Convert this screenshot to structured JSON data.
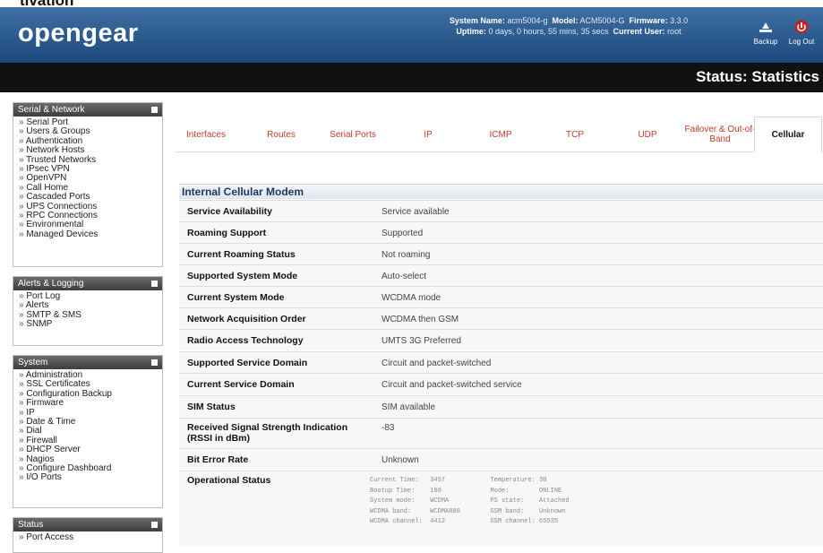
{
  "cut_title": "tivation",
  "header": {
    "logo": "opengear",
    "system_name_label": "System Name:",
    "system_name": "acm5004-g",
    "model_label": "Model:",
    "model": "ACM5004-G",
    "firmware_label": "Firmware:",
    "firmware": "3.3.0",
    "uptime_label": "Uptime:",
    "uptime": "0 days, 0 hours, 55 mins, 35 secs",
    "user_label": "Current User:",
    "user": "root",
    "backup_label": "Backup",
    "logout_label": "Log Out"
  },
  "page_title": "Status: Statistics",
  "sidebar": {
    "serial_network": {
      "title": "Serial & Network",
      "items": [
        "Serial Port",
        "Users & Groups",
        "Authentication",
        "Network Hosts",
        "Trusted Networks",
        "IPsec VPN",
        "OpenVPN",
        "Call Home",
        "Cascaded Ports",
        "UPS Connections",
        "RPC Connections",
        "Environmental",
        "Managed Devices"
      ]
    },
    "alerts_logging": {
      "title": "Alerts & Logging",
      "items": [
        "Port Log",
        "Alerts",
        "SMTP & SMS",
        "SNMP"
      ]
    },
    "system": {
      "title": "System",
      "items": [
        "Administration",
        "SSL Certificates",
        "Configuration Backup",
        "Firmware",
        "IP",
        "Date & Time",
        "Dial",
        "Firewall",
        "DHCP Server",
        "Nagios",
        "Configure Dashboard",
        "I/O Ports"
      ]
    },
    "status": {
      "title": "Status",
      "items": [
        "Port Access"
      ]
    }
  },
  "tabs": [
    "Interfaces",
    "Routes",
    "Serial Ports",
    "IP",
    "ICMP",
    "TCP",
    "UDP",
    "Failover & Out-of-Band",
    "Cellular"
  ],
  "active_tab": "Cellular",
  "section_title": "Internal Cellular Modem",
  "rows": [
    {
      "label": "Service Availability",
      "value": "Service available"
    },
    {
      "label": "Roaming Support",
      "value": "Supported"
    },
    {
      "label": "Current Roaming Status",
      "value": "Not roaming"
    },
    {
      "label": "Supported System Mode",
      "value": "Auto-select"
    },
    {
      "label": "Current System Mode",
      "value": "WCDMA mode"
    },
    {
      "label": "Network Acquisition Order",
      "value": "WCDMA then GSM"
    },
    {
      "label": "Radio Access Technology",
      "value": "UMTS 3G Preferred"
    },
    {
      "label": "Supported Service Domain",
      "value": "Circuit and packet-switched"
    },
    {
      "label": "Current Service Domain",
      "value": "Circuit and packet-switched service"
    },
    {
      "label": "SIM Status",
      "value": "SIM available"
    },
    {
      "label": "Received Signal Strength Indication (RSSI in dBm)",
      "value": "-83"
    },
    {
      "label": "Bit Error Rate",
      "value": "Unknown"
    },
    {
      "label": "Operational Status",
      "value": ""
    }
  ],
  "operational_status": [
    "Current Time:   3457            Temperature: 30",
    "Bootup Time:    100             Mode:        ONLINE",
    "System mode:    WCDMA           PS state:    Attached",
    "WCDMA band:     WCDMA800        GSM band:    Unknown",
    "WCDMA channel:  4412            GSM channel: 65535"
  ]
}
